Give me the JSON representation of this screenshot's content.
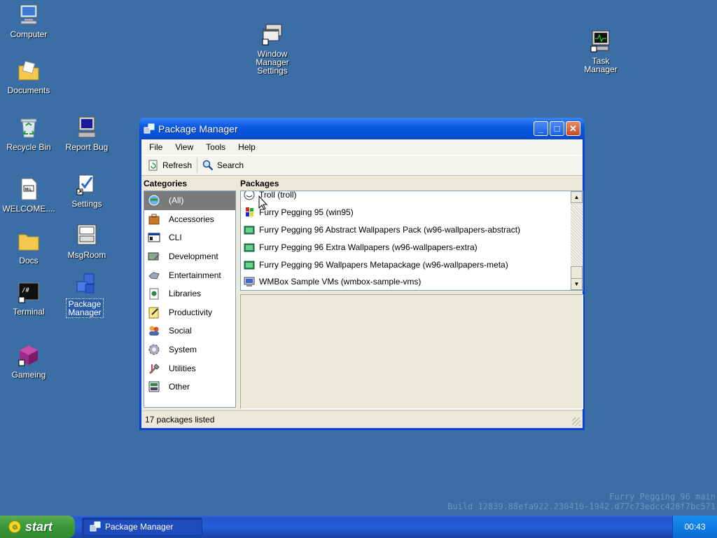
{
  "desktop": {
    "icons": {
      "computer": "Computer",
      "documents": "Documents",
      "recycle_bin": "Recycle Bin",
      "report_bug": "Report Bug",
      "welcome": "WELCOME....",
      "settings": "Settings",
      "docs": "Docs",
      "msgroom": "MsgRoom",
      "terminal": "Terminal",
      "package_manager": "Package\nManager",
      "gameing": "Gameing",
      "wm_settings": "Window\nManager\nSettings",
      "task_manager": "Task\nManager"
    },
    "build_line1": "Furry Pegging 96 main",
    "build_line2": "Build 12839.88efa922.230410-1942.d77c73edcc428f7bc571"
  },
  "window": {
    "title": "Package Manager",
    "menu": [
      "File",
      "View",
      "Tools",
      "Help"
    ],
    "toolbar": {
      "refresh": "Refresh",
      "search": "Search"
    },
    "categories_header": "Categories",
    "packages_header": "Packages",
    "categories": [
      {
        "label": "(All)",
        "icon": "all-icon",
        "selected": true
      },
      {
        "label": "Accessories",
        "icon": "accessories-icon"
      },
      {
        "label": "CLI",
        "icon": "cli-icon"
      },
      {
        "label": "Development",
        "icon": "development-icon"
      },
      {
        "label": "Entertainment",
        "icon": "entertainment-icon"
      },
      {
        "label": "Libraries",
        "icon": "libraries-icon"
      },
      {
        "label": "Productivity",
        "icon": "productivity-icon"
      },
      {
        "label": "Social",
        "icon": "social-icon"
      },
      {
        "label": "System",
        "icon": "system-icon"
      },
      {
        "label": "Utilities",
        "icon": "utilities-icon"
      },
      {
        "label": "Other",
        "icon": "other-icon"
      }
    ],
    "packages": [
      {
        "label": "Troll (troll)",
        "icon": "troll-icon"
      },
      {
        "label": "Furry Pegging 95 (win95)",
        "icon": "win95-icon"
      },
      {
        "label": "Furry Pegging 96 Abstract Wallpapers Pack (w96-wallpapers-abstract)",
        "icon": "wallpaper-icon"
      },
      {
        "label": "Furry Pegging 96 Extra Wallpapers (w96-wallpapers-extra)",
        "icon": "wallpaper-icon"
      },
      {
        "label": "Furry Pegging 96 Wallpapers Metapackage (w96-wallpapers-meta)",
        "icon": "wallpaper-icon"
      },
      {
        "label": "WMBox Sample VMs (wmbox-sample-vms)",
        "icon": "vm-icon"
      }
    ],
    "status": "17 packages listed",
    "buttons": {
      "minimize": "_",
      "maximize": "□",
      "close": "✕"
    }
  },
  "taskbar": {
    "start": "start",
    "task": "Package Manager",
    "clock": "00:43"
  }
}
